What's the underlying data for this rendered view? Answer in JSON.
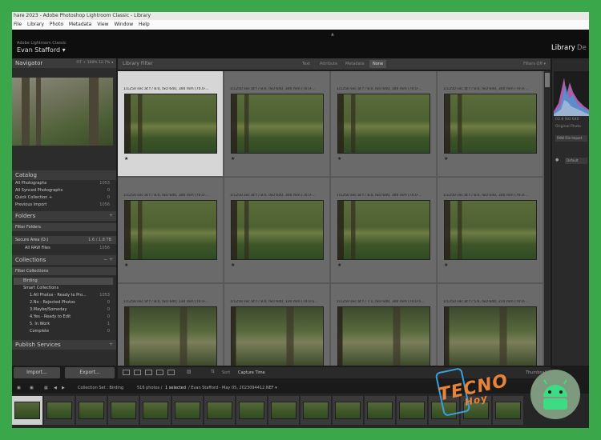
{
  "window": {
    "title": "hare 2023 - Adobe Photoshop Lightroom Classic - Library",
    "menu": [
      "File",
      "Library",
      "Photo",
      "Metadata",
      "View",
      "Window",
      "Help"
    ]
  },
  "identity": {
    "app_name": "Adobe Lightroom Classic",
    "user": "Evan Stafford ▾",
    "modules": [
      "Library",
      "De"
    ]
  },
  "navigator": {
    "title": "Navigator",
    "zoom_options": "FIT ÷  100%  12.7%  ◂"
  },
  "catalog": {
    "title": "Catalog",
    "items": [
      {
        "label": "All Photographs",
        "count": "1053"
      },
      {
        "label": "All Synced Photographs",
        "count": "0"
      },
      {
        "label": "Quick Collection +",
        "count": "0"
      },
      {
        "label": "Previous Import",
        "count": "1056"
      }
    ]
  },
  "folders": {
    "title": "Folders",
    "filter": "Filter Folders",
    "volume": "Secure Area (D:)",
    "volume_info": "1.6 / 1.8 TB",
    "items": [
      {
        "label": "All RAW Files",
        "count": "1056"
      }
    ]
  },
  "collections": {
    "title": "Collections",
    "filter": "Filter Collections",
    "items": [
      {
        "label": "Birding",
        "count": ""
      },
      {
        "label": "Smart Collections",
        "count": ""
      },
      {
        "label": "1.All Photos - Ready to Pro...",
        "count": "1053"
      },
      {
        "label": "2.No - Rejected Photos",
        "count": "0"
      },
      {
        "label": "3.Maybe/Someday",
        "count": "0"
      },
      {
        "label": "4.Yes - Ready to Edit",
        "count": "0"
      },
      {
        "label": "5. In Work",
        "count": "1"
      },
      {
        "label": "Complete",
        "count": "0"
      }
    ]
  },
  "publish": {
    "title": "Publish Services"
  },
  "buttons": {
    "import": "Import...",
    "export": "Export..."
  },
  "filter_bar": {
    "title": "Library Filter",
    "tabs": [
      "Text",
      "Attribute",
      "Metadata",
      "None"
    ],
    "selected": "None",
    "filters_off": "Filters Off ▾"
  },
  "grid": {
    "captions": [
      "1/1250 sec at f / 8.0, ISO 640, 300 mm (70.0-...",
      "1/1250 sec at f / 8.0, ISO 640, 300 mm (70.0-...",
      "1/1250 sec at f / 8.0, ISO 640, 300 mm (70.0-...",
      "1/1250 sec at f / 8.0, ISO 640, 300 mm (70.0-...",
      "1/1250 sec at f / 8.0, ISO 640, 300 mm (70.0-...",
      "1/1250 sec at f / 8.0, ISO 640, 300 mm (70.0-...",
      "1/1250 sec at f / 8.0, ISO 640, 300 mm (70.0-...",
      "1/1250 sec at f / 8.0, ISO 640, 300 mm (70.0-...",
      "1/1250 sec at f / 8.0, ISO 640, 130 mm (70.0-...",
      "1/1250 sec at f / 8.0, ISO 640, 130 mm (70.0-5...",
      "1/1250 sec at f / 7.1, ISO 640, 300 mm (70.0-5...",
      "1/1250 sec at f / 5.6, ISO 640, 210 mm (70.0-..."
    ],
    "star": "★"
  },
  "right_panel": {
    "histogram_info": "f/2.8   ISO 640",
    "original_photo": "Original Photo",
    "raw_label": "RAW File Import",
    "preset_label": "Default"
  },
  "toolbar": {
    "sort_label": "Sort",
    "sort_value": "Capture Time",
    "thumbnails_label": "Thumbnails"
  },
  "filmstrip": {
    "collection": "Collection Set : Birding",
    "count": "516 photos /",
    "selected": "1 selected",
    "file": "/ Evan Stafford - May 05, 2023094412.NEF ▾"
  },
  "watermark": {
    "brand": "TECNO",
    "sub": "Hoy"
  },
  "colors": {
    "accent_green": "#3aa84a",
    "watermark_orange": "#e8843a",
    "watermark_blue": "#3a9fdc"
  }
}
